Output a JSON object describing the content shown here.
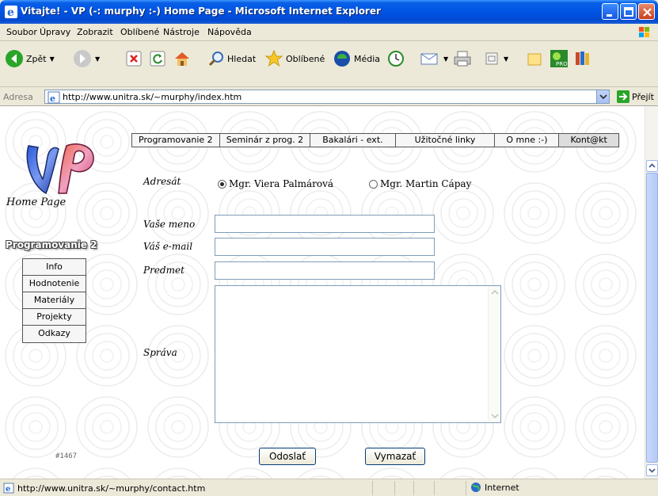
{
  "window": {
    "title": "Vitajte! - VP (-: murphy :-) Home Page - Microsoft Internet Explorer"
  },
  "menu": [
    "Soubor",
    "Úpravy",
    "Zobrazit",
    "Oblíbené",
    "Nástroje",
    "Nápověda"
  ],
  "toolbar": {
    "back_label": "Zpět",
    "search_label": "Hledat",
    "favorites_label": "Oblíbené",
    "media_label": "Média"
  },
  "address": {
    "label": "Adresa",
    "url": "http://www.unitra.sk/~murphy/index.htm",
    "go_label": "Přejít"
  },
  "topnav": [
    "Programovanie 2",
    "Seminár z prog. 2",
    "Bakalári - ext.",
    "Užitočné linky",
    "O mne :-)",
    "Kont@kt"
  ],
  "sidebar": {
    "home_caption": "Home Page",
    "section_title": "Programovanie 2",
    "items": [
      "Info",
      "Hodnotenie",
      "Materiály",
      "Projekty",
      "Odkazy"
    ]
  },
  "form": {
    "recipient_label": "Adresát",
    "recipients": [
      {
        "name": "Mgr. Viera Palmárová",
        "selected": true
      },
      {
        "name": "Mgr. Martin Cápay",
        "selected": false
      }
    ],
    "name_label": "Vaše meno",
    "email_label": "Váš e-mail",
    "subject_label": "Predmet",
    "message_label": "Správa",
    "name_value": "",
    "email_value": "",
    "subject_value": "",
    "message_value": "",
    "send_label": "Odoslať",
    "clear_label": "Vymazať"
  },
  "counter": "#1467",
  "status": {
    "text": "http://www.unitra.sk/~murphy/contact.htm",
    "zone": "Internet"
  },
  "colors": {
    "titlebar": "#0054e3",
    "nav_active": "#dddddd",
    "field_border": "#7f9db9"
  }
}
